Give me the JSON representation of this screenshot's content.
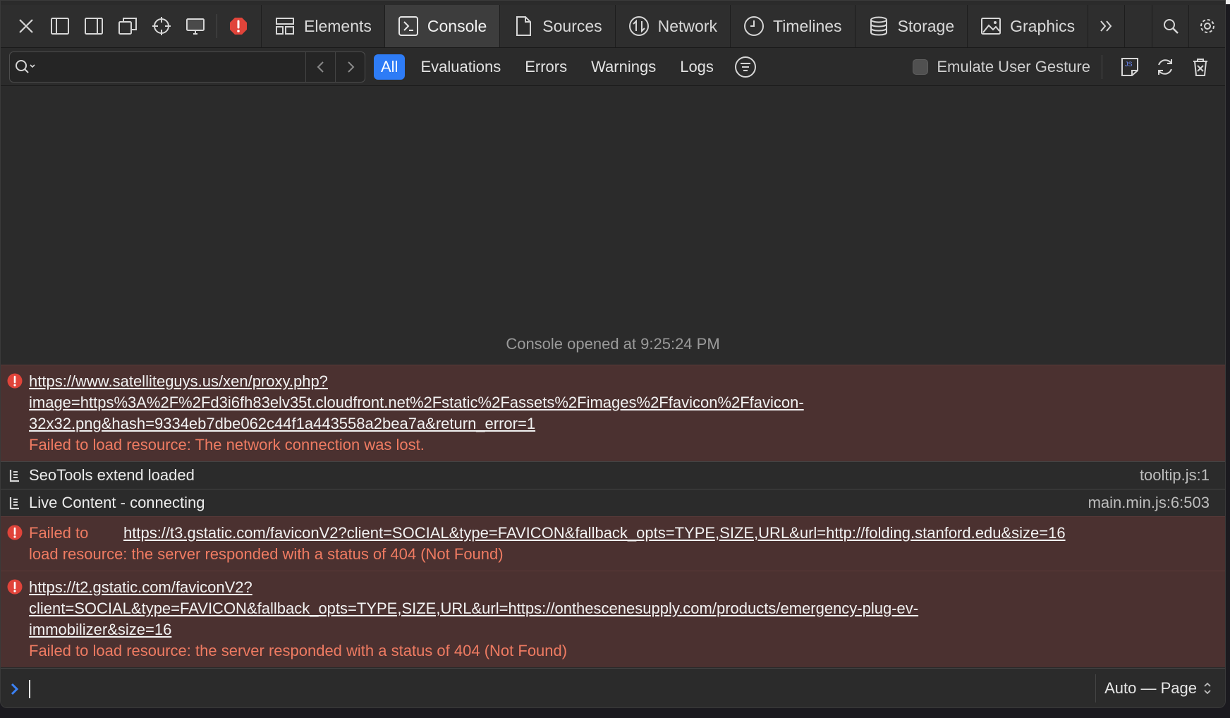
{
  "tabs": [
    {
      "label": "Elements",
      "icon": "elements-icon"
    },
    {
      "label": "Console",
      "icon": "console-icon",
      "active": true
    },
    {
      "label": "Sources",
      "icon": "sources-icon"
    },
    {
      "label": "Network",
      "icon": "network-icon"
    },
    {
      "label": "Timelines",
      "icon": "timelines-icon"
    },
    {
      "label": "Storage",
      "icon": "storage-icon"
    },
    {
      "label": "Graphics",
      "icon": "graphics-icon"
    }
  ],
  "filters": [
    "All",
    "Evaluations",
    "Errors",
    "Warnings",
    "Logs"
  ],
  "search": {
    "placeholder": ""
  },
  "emulate_label": "Emulate User Gesture",
  "console_opened": "Console opened at 9:25:24 PM",
  "messages": [
    {
      "type": "error",
      "link_lines": [
        "https://www.satelliteguys.us/xen/proxy.php?",
        "image=https%3A%2F%2Fd3i6fh83elv35t.cloudfront.net%2Fstatic%2Fassets%2Fimages%2Ffavicon%2Ffavicon-",
        "32x32.png&hash=9334eb7dbe062c44f1a443558a2bea7a&return_error=1"
      ],
      "text": "Failed to load resource: The network connection was lost."
    },
    {
      "type": "log",
      "text": "SeoTools extend loaded",
      "source": "tooltip.js:1"
    },
    {
      "type": "log",
      "text": "Live Content - connecting",
      "source": "main.min.js:6:503"
    },
    {
      "type": "error",
      "lead": "Failed to",
      "link": "https://t3.gstatic.com/faviconV2?client=SOCIAL&type=FAVICON&fallback_opts=TYPE,SIZE,URL&url=http://folding.stanford.edu&size=16",
      "text": "load resource: the server responded with a status of 404 (Not Found)"
    },
    {
      "type": "error",
      "link_lines": [
        "https://t2.gstatic.com/faviconV2?",
        "client=SOCIAL&type=FAVICON&fallback_opts=TYPE,SIZE,URL&url=https://onthescenesupply.com/products/emergency-plug-ev-",
        "immobilizer&size=16"
      ],
      "text": "Failed to load resource: the server responded with a status of 404 (Not Found)"
    }
  ],
  "context_selector": "Auto — Page",
  "colors": {
    "accent": "#2e7cf6",
    "error_bg": "#4b3130",
    "error_text": "#f0755f",
    "error_icon": "#e0443a"
  }
}
